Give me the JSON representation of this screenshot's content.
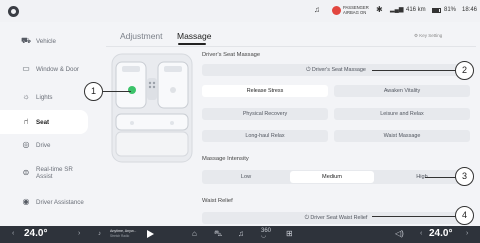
{
  "status_bar": {
    "passenger_airbag": "PASSENGER\nAIRBAG ON",
    "range": "416 km",
    "battery": "81%",
    "time": "18:46"
  },
  "sidebar": {
    "items": [
      {
        "label": "Vehicle",
        "icon": "car-icon"
      },
      {
        "label": "Window & Door",
        "icon": "window-icon"
      },
      {
        "label": "Lights",
        "icon": "light-icon"
      },
      {
        "label": "Seat",
        "icon": "seat-icon",
        "active": true
      },
      {
        "label": "Drive",
        "icon": "steering-icon"
      },
      {
        "label": "Real-time SR Assist",
        "icon": "sr-assist-icon"
      },
      {
        "label": "Driver Assistance",
        "icon": "driver-assist-icon"
      }
    ]
  },
  "tabs": [
    {
      "label": "Adjustment"
    },
    {
      "label": "Massage",
      "active": true
    }
  ],
  "key_setting": "Key Setting",
  "driver_seat_massage": {
    "section_title": "Driver's Seat Massage",
    "toggle_label": "Driver's Seat Massage",
    "programs": [
      "Release Stress",
      "Awaken Vitality",
      "Physical Recovery",
      "Leisure and Relax",
      "Long-haul Relax",
      "Waist Massage"
    ],
    "selected": "Release Stress"
  },
  "massage_intensity": {
    "section_title": "Massage Intensity",
    "options": [
      "Low",
      "Medium",
      "High"
    ],
    "selected": "Medium"
  },
  "waist_relief": {
    "section_title": "Waist Relief",
    "toggle_label": "Driver Seat Waist Relief"
  },
  "callouts": [
    "1",
    "2",
    "3",
    "4"
  ],
  "dock": {
    "left_temp": "24.0°",
    "right_temp": "24.0°",
    "media_title": "Anytime, Anyw...",
    "media_sub": "Stretch Radio",
    "fan_label": "360"
  },
  "colors": {
    "accent_green": "#3cc36a",
    "airbag_red": "#e2463f",
    "dock_bg": "#2e333b"
  }
}
